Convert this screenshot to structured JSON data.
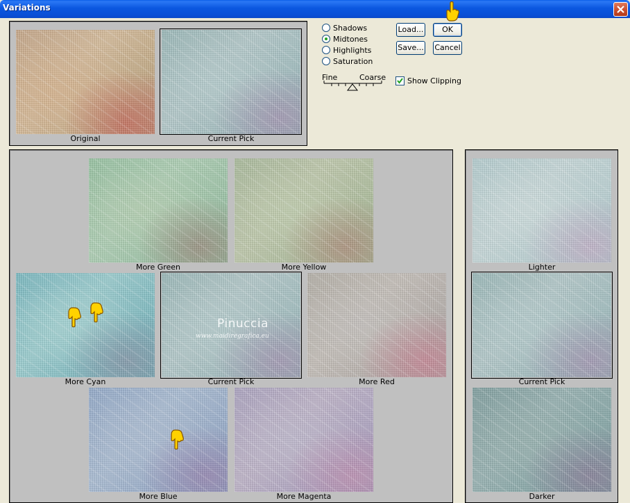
{
  "window": {
    "title": "Variations"
  },
  "top_panel": {
    "original_caption": "Original",
    "current_pick_caption": "Current Pick"
  },
  "options": {
    "radios": [
      {
        "label": "Shadows",
        "selected": false
      },
      {
        "label": "Midtones",
        "selected": true
      },
      {
        "label": "Highlights",
        "selected": false
      },
      {
        "label": "Saturation",
        "selected": false
      }
    ],
    "slider": {
      "left_label": "Fine",
      "right_label": "Coarse"
    },
    "show_clipping": {
      "label": "Show Clipping",
      "checked": true
    }
  },
  "buttons": {
    "load": "Load...",
    "ok": "OK",
    "save": "Save...",
    "cancel": "Cancel"
  },
  "color_panel": {
    "more_green": "More Green",
    "more_yellow": "More Yellow",
    "more_cyan": "More Cyan",
    "current_pick": "Current Pick",
    "more_red": "More Red",
    "more_blue": "More Blue",
    "more_magenta": "More Magenta"
  },
  "brightness_panel": {
    "lighter": "Lighter",
    "current_pick": "Current Pick",
    "darker": "Darker"
  },
  "watermark": {
    "name": "Pinuccia",
    "url": "www.maidiregrafica.eu"
  },
  "colors": {
    "titlebar": "#0a4fd6",
    "dialog_bg": "#ece9d8",
    "panel_bg": "#c0c0c0"
  }
}
